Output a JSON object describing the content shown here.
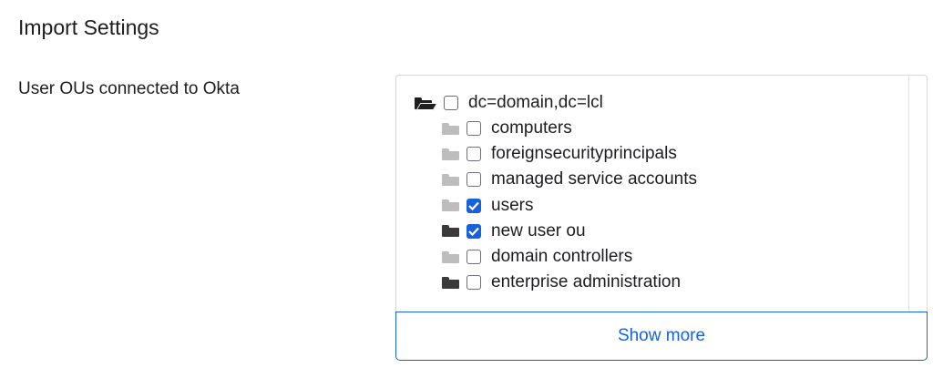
{
  "section": {
    "title": "Import Settings"
  },
  "field": {
    "label": "User OUs connected to Okta"
  },
  "tree": {
    "root": {
      "label": "dc=domain,dc=lcl",
      "checked": false,
      "icon": "folder-open-icon"
    },
    "children": [
      {
        "label": "computers",
        "checked": false,
        "folder": "gray"
      },
      {
        "label": "foreignsecurityprincipals",
        "checked": false,
        "folder": "gray"
      },
      {
        "label": "managed service accounts",
        "checked": false,
        "folder": "gray"
      },
      {
        "label": "users",
        "checked": true,
        "folder": "gray"
      },
      {
        "label": "new user ou",
        "checked": true,
        "folder": "dark"
      },
      {
        "label": "domain controllers",
        "checked": false,
        "folder": "gray"
      },
      {
        "label": "enterprise administration",
        "checked": false,
        "folder": "dark"
      }
    ]
  },
  "show_more": {
    "label": "Show more"
  },
  "colors": {
    "accent": "#1662dd",
    "folder_gray": "#bdbdbd",
    "folder_dark": "#3a3a3a"
  }
}
